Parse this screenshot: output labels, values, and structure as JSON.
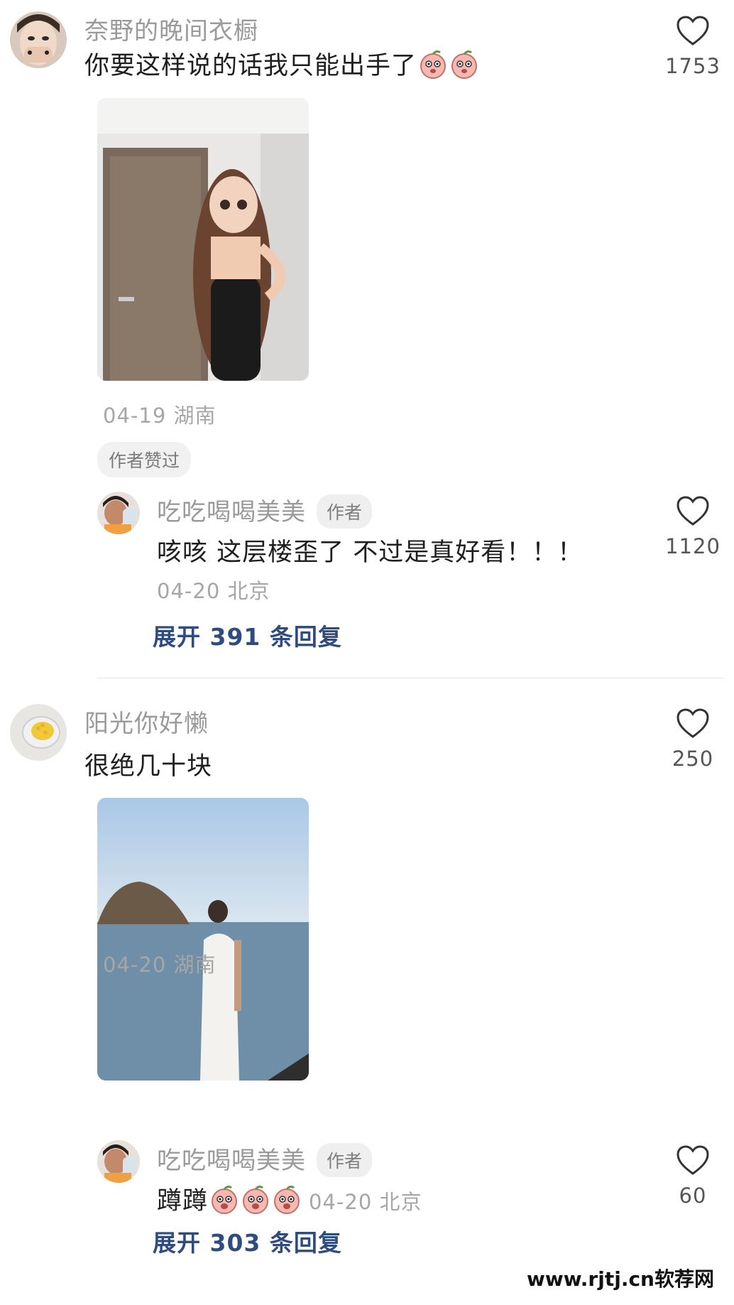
{
  "comments": [
    {
      "username": "奈野的晚间衣橱",
      "text": "你要这样说的话我只能出手了",
      "emoji": [
        "peach-emoji",
        "peach-emoji"
      ],
      "date_location": "04-19 湖南",
      "badge": "作者赞过",
      "likes": "1753",
      "reply": {
        "username": "吃吃喝喝美美",
        "author_tag": "作者",
        "text": "咳咳 这层楼歪了 不过是真好看！！！",
        "date_location": "04-20 北京",
        "likes": "1120"
      },
      "expand_label": "展开 391 条回复"
    },
    {
      "username": "阳光你好懒",
      "text": "很绝几十块",
      "date_location": "04-20 湖南",
      "likes": "250",
      "reply": {
        "username": "吃吃喝喝美美",
        "author_tag": "作者",
        "text": "蹲蹲",
        "emoji": [
          "peach-emoji",
          "peach-emoji",
          "peach-emoji"
        ],
        "date_location": "04-20 北京",
        "likes": "60"
      },
      "expand_label": "展开 303 条回复"
    }
  ],
  "watermark": "www.rjtj.cn软荐网",
  "colors": {
    "username": "#9a9a9a",
    "expand_link": "#2e4c80",
    "badge_bg": "#f1f1f1"
  }
}
